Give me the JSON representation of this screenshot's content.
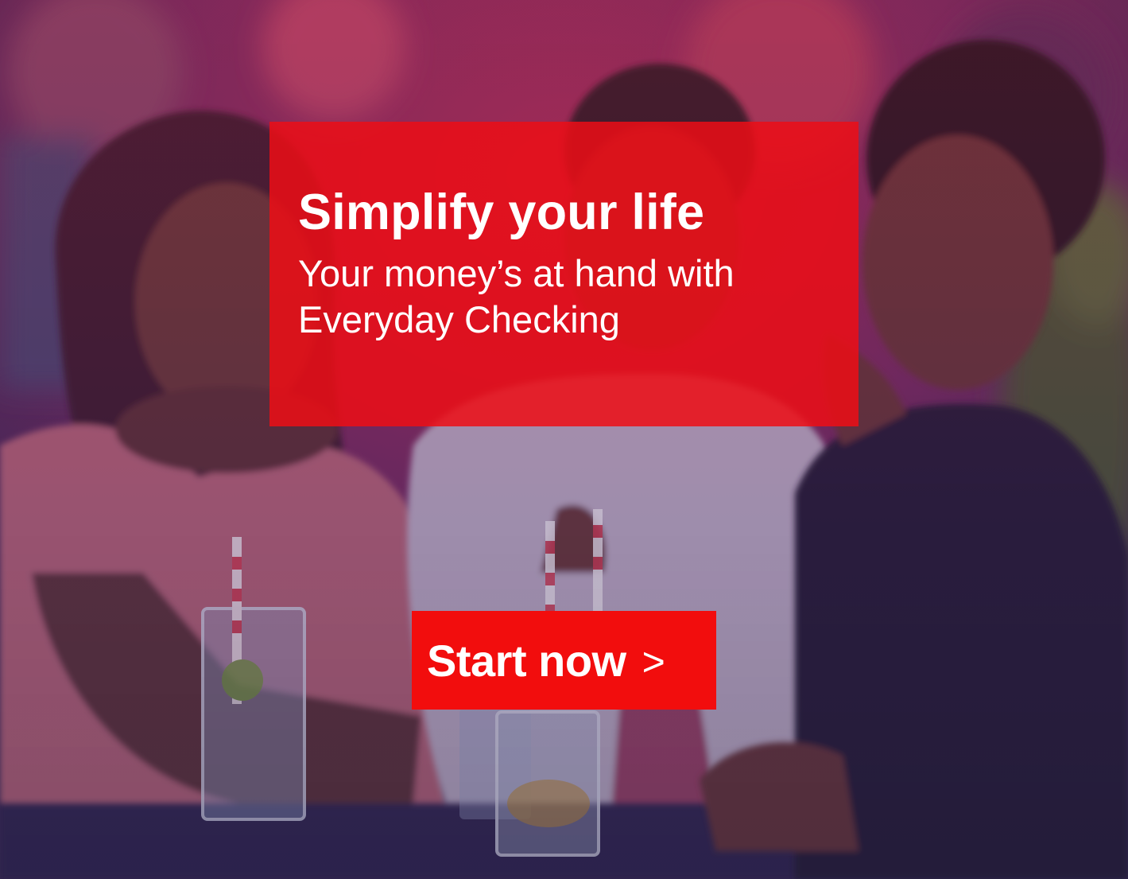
{
  "banner": {
    "headline": "Simplify your life",
    "subline": "Your money’s at hand with Everyday Checking",
    "cta": {
      "label": "Start now",
      "chevron": ">"
    }
  },
  "colors": {
    "headline_box": "#ec0e16",
    "cta_background": "#f20d0d",
    "text": "#ffffff"
  },
  "icons": {
    "cta_chevron": "chevron-right-icon"
  }
}
